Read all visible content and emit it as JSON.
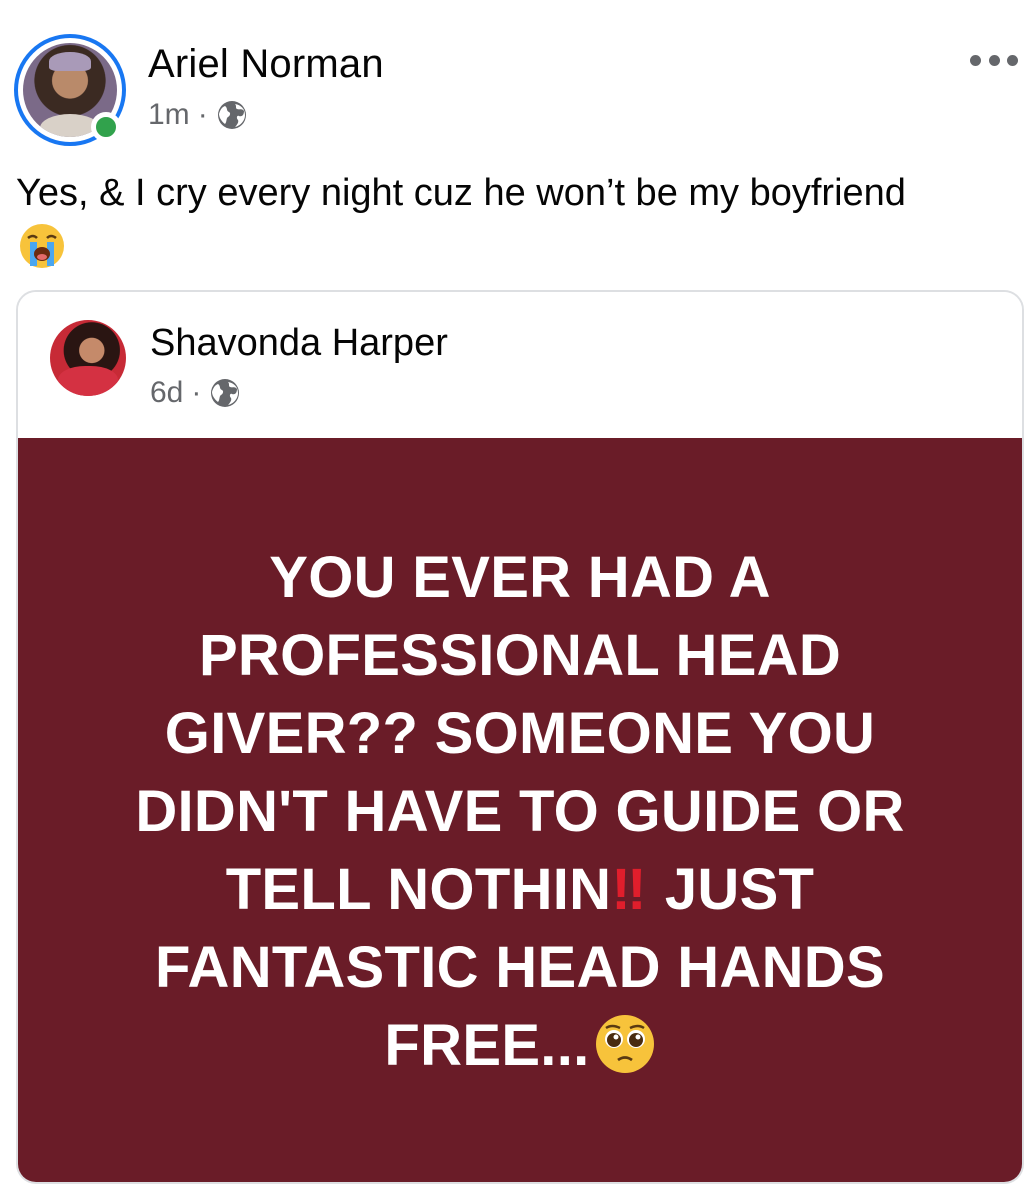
{
  "post": {
    "author_name": "Ariel Norman",
    "timestamp": "1m",
    "separator": "·",
    "audience_icon": "globe-icon",
    "text": "Yes, & I cry every night cuz he won’t be my boyfriend",
    "emoji": "loudly-crying-face",
    "more_icon": "more-horizontal-icon",
    "online_status": "online"
  },
  "shared_post": {
    "author_name": "Shavonda Harper",
    "timestamp": "6d",
    "separator": "·",
    "audience_icon": "globe-icon",
    "text_part_1": "YOU EVER HAD A PROFESSIONAL HEAD GIVER?? SOMEONE YOU DIDN'T HAVE TO GUIDE OR TELL NOTHIN",
    "double_exclamation": "‼",
    "text_part_2": " JUST FANTASTIC HEAD HANDS FREE...",
    "trailing_emoji": "pleading-face",
    "background_color": "#6a1c28"
  },
  "colors": {
    "accent": "#1877f2",
    "online": "#31a24c",
    "secondary_text": "#65676b"
  }
}
